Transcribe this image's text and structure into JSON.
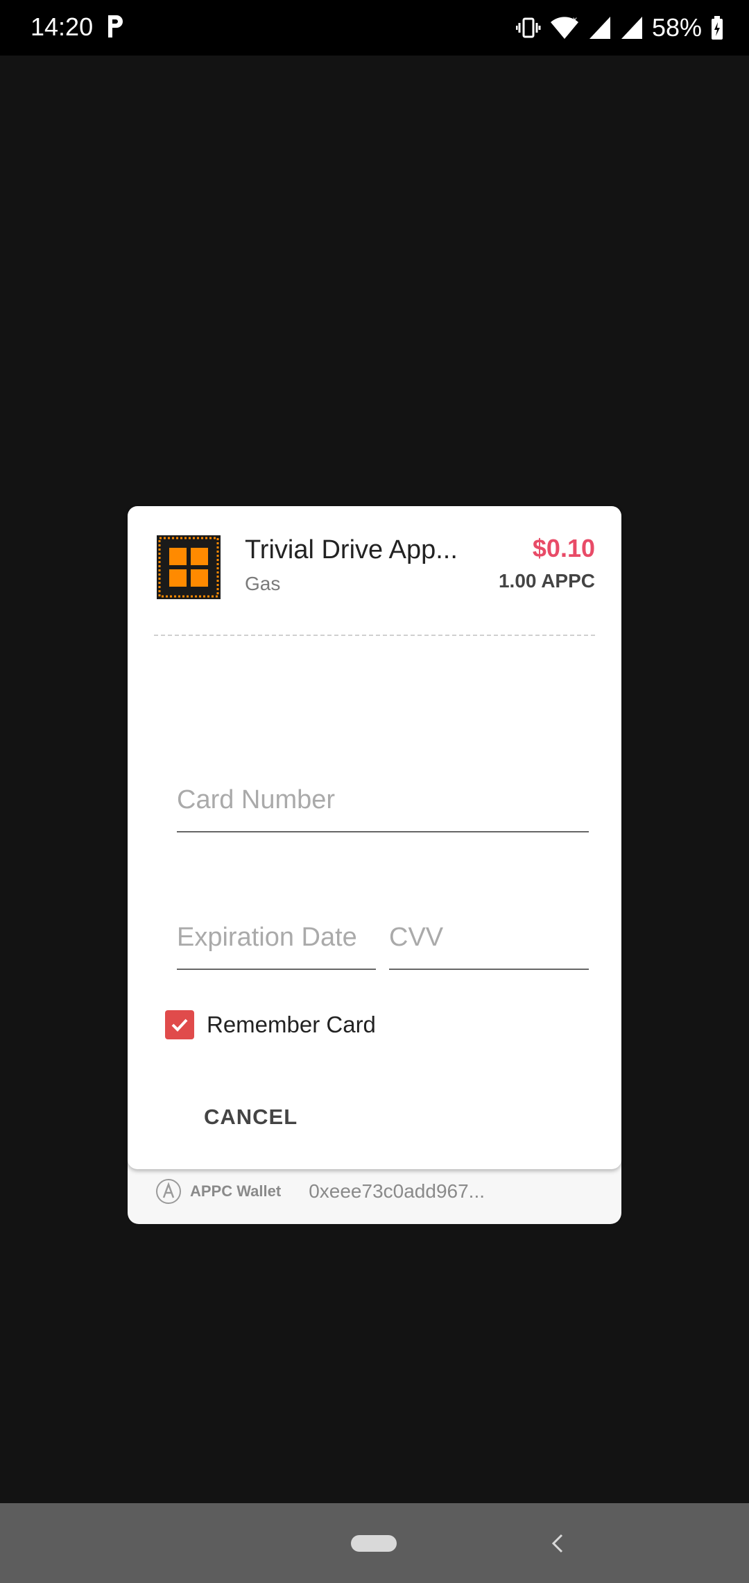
{
  "status_bar": {
    "time": "14:20",
    "battery": "58%",
    "icons": [
      "parking-icon",
      "vibrate-icon",
      "wifi-icon",
      "signal-icon",
      "signal-icon",
      "battery-charging-icon"
    ]
  },
  "payment": {
    "app_name": "Trivial Drive App...",
    "product": "Gas",
    "price_fiat": "$0.10",
    "price_appc": "1.00 APPC",
    "price_color": "#e84b67"
  },
  "form": {
    "card_number_placeholder": "Card Number",
    "expiration_placeholder": "Expiration Date",
    "cvv_placeholder": "CVV",
    "remember_card_label": "Remember Card",
    "remember_card_checked": true,
    "checkbox_color": "#e04b4b"
  },
  "actions": {
    "cancel_label": "CANCEL"
  },
  "wallet": {
    "label": "APPC Wallet",
    "address": "0xeee73c0add967..."
  }
}
